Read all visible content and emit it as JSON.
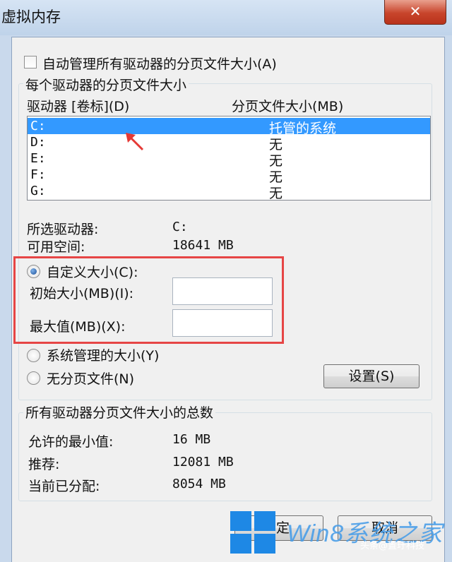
{
  "window": {
    "title": "虚拟内存",
    "close_glyph": "✕"
  },
  "auto_manage": {
    "label": "自动管理所有驱动器的分页文件大小(A)",
    "checked": false
  },
  "drive_group": {
    "title": "每个驱动器的分页文件大小",
    "col_drive": "驱动器 [卷标](D)",
    "col_size": "分页文件大小(MB)",
    "rows": [
      {
        "drive": "C:",
        "size": "托管的系统",
        "selected": true
      },
      {
        "drive": "D:",
        "size": "无",
        "selected": false
      },
      {
        "drive": "E:",
        "size": "无",
        "selected": false
      },
      {
        "drive": "F:",
        "size": "无",
        "selected": false
      },
      {
        "drive": "G:",
        "size": "无",
        "selected": false
      }
    ],
    "selected_drive_label": "所选驱动器:",
    "selected_drive_value": "C:",
    "free_space_label": "可用空间:",
    "free_space_value": "18641 MB",
    "custom_size_label": "自定义大小(C):",
    "initial_size_label": "初始大小(MB)(I):",
    "initial_size_value": "",
    "max_size_label": "最大值(MB)(X):",
    "max_size_value": "",
    "system_managed_label": "系统管理的大小(Y)",
    "no_paging_label": "无分页文件(N)",
    "set_button": "设置(S)",
    "selected_option": "custom"
  },
  "total_group": {
    "title": "所有驱动器分页文件大小的总数",
    "min_label": "允许的最小值:",
    "min_value": "16 MB",
    "recommended_label": "推荐:",
    "recommended_value": "12081 MB",
    "current_label": "当前已分配:",
    "current_value": "8054 MB"
  },
  "footer": {
    "ok_button": "定",
    "cancel_button": "取消"
  },
  "watermark": {
    "text": "Win8系统之家",
    "sub": "头条@置玗科技"
  },
  "colors": {
    "selection": "#3399ff",
    "highlight_box": "#e64545",
    "close_button": "#c8442b"
  }
}
